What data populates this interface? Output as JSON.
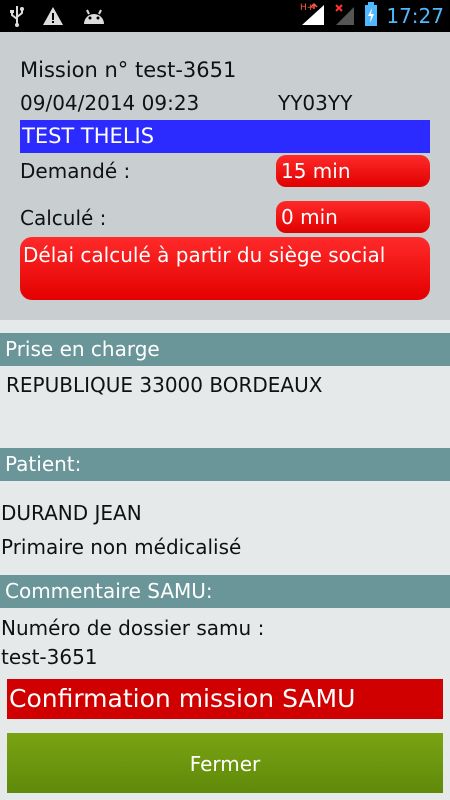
{
  "status_bar": {
    "time": "17:27",
    "left_icons": [
      "usb-icon",
      "warning-icon",
      "android-icon"
    ],
    "right_icons": [
      "signal-hplus-icon",
      "no-signal-icon",
      "battery-charging-icon"
    ],
    "network_label": "H+"
  },
  "mission": {
    "title": "Mission n° test-3651",
    "datetime": "09/04/2014 09:23",
    "plate": "YY03YY",
    "client": "TEST THELIS",
    "requested_label": "Demandé :",
    "requested_value": "15 min",
    "computed_label": "Calculé :",
    "computed_value": "0 min",
    "delay_note": "Délai calculé à partir du siège social"
  },
  "pickup": {
    "header": "Prise en charge",
    "address": "REPUBLIQUE 33000 BORDEAUX"
  },
  "patient": {
    "header": "Patient:",
    "name": "DURAND JEAN",
    "type": "Primaire non médicalisé"
  },
  "comment": {
    "header": "Commentaire SAMU:",
    "line1": "Numéro de dossier samu :",
    "line2": "test-3651"
  },
  "actions": {
    "confirm_label": "Confirmation mission SAMU",
    "close_label": "Fermer"
  },
  "colors": {
    "section_header": "#6a9699",
    "alert_red": "#ff2a2a",
    "client_blue": "#2b2bff",
    "close_green": "#6e9a10"
  }
}
